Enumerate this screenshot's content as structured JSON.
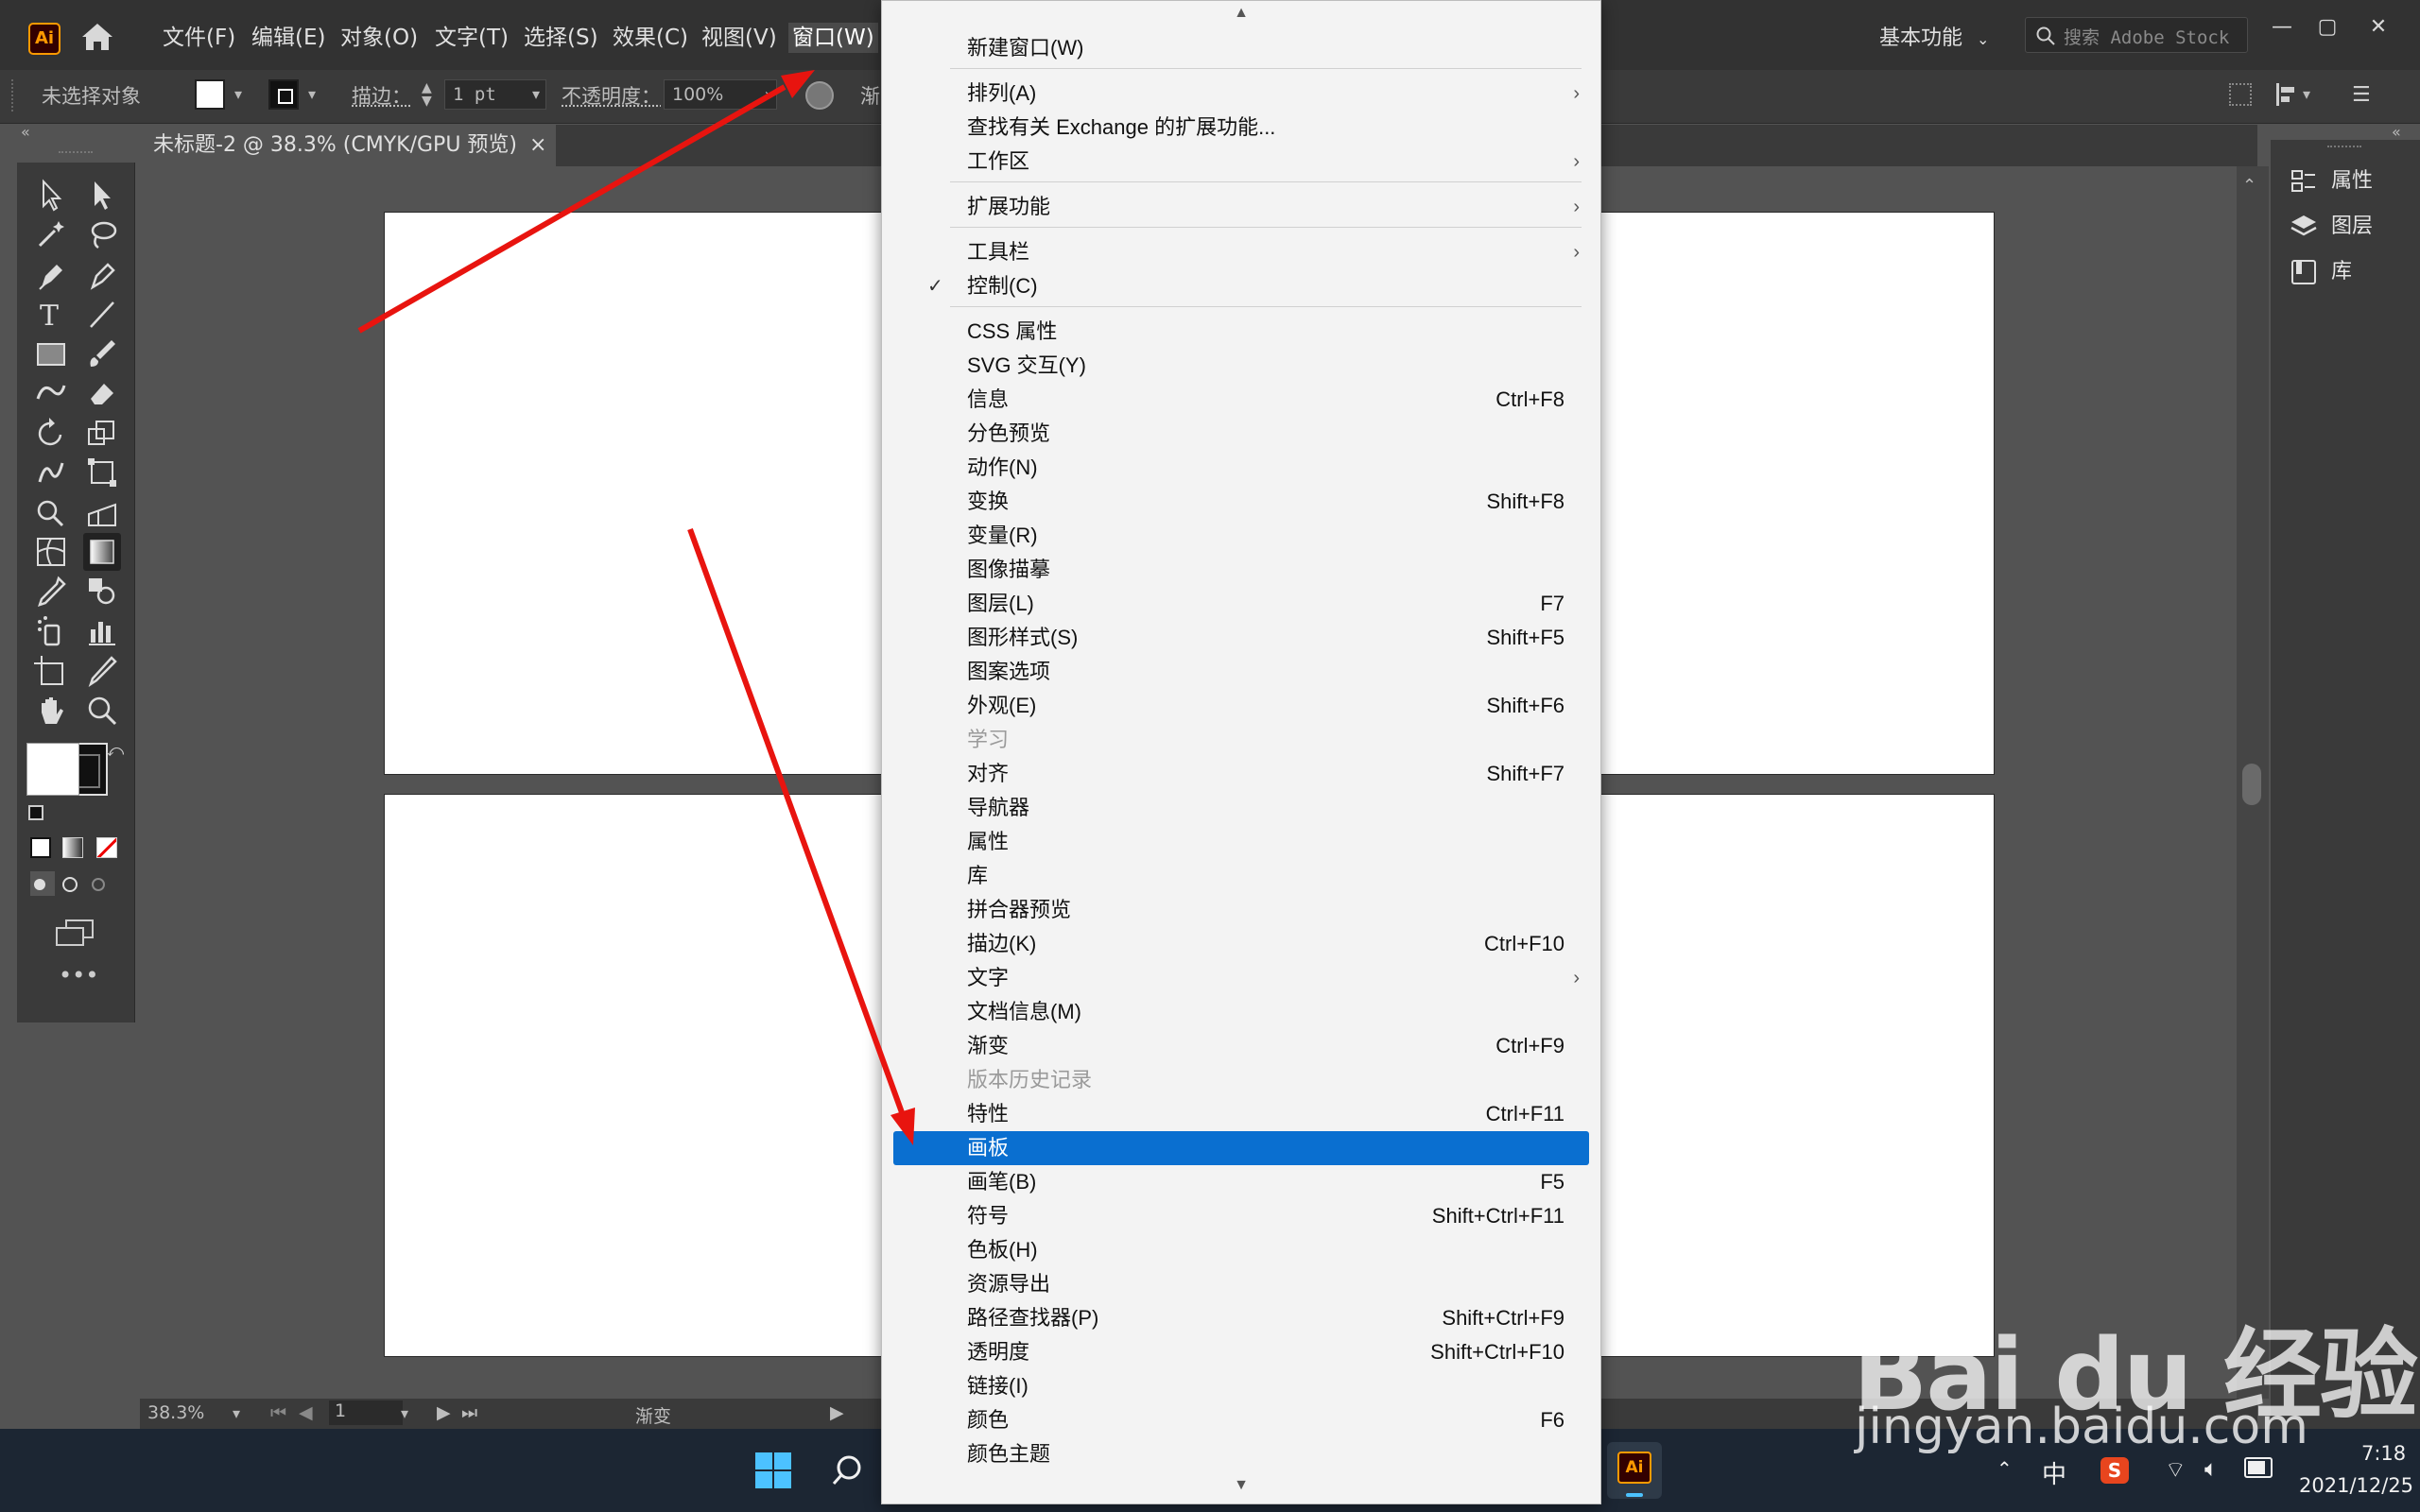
{
  "app": {
    "logo_text": "Ai",
    "accent": "#ff9a00"
  },
  "menubar": {
    "items": [
      "文件(F)",
      "编辑(E)",
      "对象(O)",
      "文字(T)",
      "选择(S)",
      "效果(C)",
      "视图(V)",
      "窗口(W)"
    ],
    "active": "窗口(W)",
    "workspace": "基本功能",
    "search_placeholder": "搜索 Adobe Stock"
  },
  "controlbar": {
    "selection": "未选择对象",
    "stroke_label": "描边：",
    "stroke_value": "1 pt",
    "opacity_label": "不透明度：",
    "opacity_value": "100%",
    "truncated_label": "渐"
  },
  "document_tab": {
    "title": "未标题-2 @ 38.3% (CMYK/GPU 预览)",
    "close": "×"
  },
  "statusbar": {
    "zoom": "38.3%",
    "artboard_index": "1",
    "tool_name": "渐变"
  },
  "right_panel": {
    "items": [
      "属性",
      "图层",
      "库"
    ]
  },
  "window_menu": {
    "items": [
      {
        "label": "新建窗口(W)",
        "shortcut": "",
        "submenu": false,
        "checked": false,
        "disabled": false,
        "selected": false
      },
      {
        "label": "排列(A)",
        "shortcut": "",
        "submenu": true,
        "checked": false,
        "disabled": false,
        "selected": false,
        "sep_before": true
      },
      {
        "label": "查找有关 Exchange 的扩展功能...",
        "shortcut": "",
        "submenu": false,
        "checked": false,
        "disabled": false,
        "selected": false
      },
      {
        "label": "工作区",
        "shortcut": "",
        "submenu": true,
        "checked": false,
        "disabled": false,
        "selected": false
      },
      {
        "label": "扩展功能",
        "shortcut": "",
        "submenu": true,
        "checked": false,
        "disabled": false,
        "selected": false,
        "sep_before": true
      },
      {
        "label": "工具栏",
        "shortcut": "",
        "submenu": true,
        "checked": false,
        "disabled": false,
        "selected": false,
        "sep_before": true
      },
      {
        "label": "控制(C)",
        "shortcut": "",
        "submenu": false,
        "checked": true,
        "disabled": false,
        "selected": false
      },
      {
        "label": "CSS 属性",
        "shortcut": "",
        "submenu": false,
        "checked": false,
        "disabled": false,
        "selected": false,
        "sep_before": true
      },
      {
        "label": "SVG 交互(Y)",
        "shortcut": "",
        "submenu": false,
        "checked": false,
        "disabled": false,
        "selected": false
      },
      {
        "label": "信息",
        "shortcut": "Ctrl+F8",
        "submenu": false,
        "checked": false,
        "disabled": false,
        "selected": false
      },
      {
        "label": "分色预览",
        "shortcut": "",
        "submenu": false,
        "checked": false,
        "disabled": false,
        "selected": false
      },
      {
        "label": "动作(N)",
        "shortcut": "",
        "submenu": false,
        "checked": false,
        "disabled": false,
        "selected": false
      },
      {
        "label": "变换",
        "shortcut": "Shift+F8",
        "submenu": false,
        "checked": false,
        "disabled": false,
        "selected": false
      },
      {
        "label": "变量(R)",
        "shortcut": "",
        "submenu": false,
        "checked": false,
        "disabled": false,
        "selected": false
      },
      {
        "label": "图像描摹",
        "shortcut": "",
        "submenu": false,
        "checked": false,
        "disabled": false,
        "selected": false
      },
      {
        "label": "图层(L)",
        "shortcut": "F7",
        "submenu": false,
        "checked": false,
        "disabled": false,
        "selected": false
      },
      {
        "label": "图形样式(S)",
        "shortcut": "Shift+F5",
        "submenu": false,
        "checked": false,
        "disabled": false,
        "selected": false
      },
      {
        "label": "图案选项",
        "shortcut": "",
        "submenu": false,
        "checked": false,
        "disabled": false,
        "selected": false
      },
      {
        "label": "外观(E)",
        "shortcut": "Shift+F6",
        "submenu": false,
        "checked": false,
        "disabled": false,
        "selected": false
      },
      {
        "label": "学习",
        "shortcut": "",
        "submenu": false,
        "checked": false,
        "disabled": true,
        "selected": false
      },
      {
        "label": "对齐",
        "shortcut": "Shift+F7",
        "submenu": false,
        "checked": false,
        "disabled": false,
        "selected": false
      },
      {
        "label": "导航器",
        "shortcut": "",
        "submenu": false,
        "checked": false,
        "disabled": false,
        "selected": false
      },
      {
        "label": "属性",
        "shortcut": "",
        "submenu": false,
        "checked": false,
        "disabled": false,
        "selected": false
      },
      {
        "label": "库",
        "shortcut": "",
        "submenu": false,
        "checked": false,
        "disabled": false,
        "selected": false
      },
      {
        "label": "拼合器预览",
        "shortcut": "",
        "submenu": false,
        "checked": false,
        "disabled": false,
        "selected": false
      },
      {
        "label": "描边(K)",
        "shortcut": "Ctrl+F10",
        "submenu": false,
        "checked": false,
        "disabled": false,
        "selected": false
      },
      {
        "label": "文字",
        "shortcut": "",
        "submenu": true,
        "checked": false,
        "disabled": false,
        "selected": false
      },
      {
        "label": "文档信息(M)",
        "shortcut": "",
        "submenu": false,
        "checked": false,
        "disabled": false,
        "selected": false
      },
      {
        "label": "渐变",
        "shortcut": "Ctrl+F9",
        "submenu": false,
        "checked": false,
        "disabled": false,
        "selected": false
      },
      {
        "label": "版本历史记录",
        "shortcut": "",
        "submenu": false,
        "checked": false,
        "disabled": true,
        "selected": false
      },
      {
        "label": "特性",
        "shortcut": "Ctrl+F11",
        "submenu": false,
        "checked": false,
        "disabled": false,
        "selected": false
      },
      {
        "label": "画板",
        "shortcut": "",
        "submenu": false,
        "checked": false,
        "disabled": false,
        "selected": true
      },
      {
        "label": "画笔(B)",
        "shortcut": "F5",
        "submenu": false,
        "checked": false,
        "disabled": false,
        "selected": false
      },
      {
        "label": "符号",
        "shortcut": "Shift+Ctrl+F11",
        "submenu": false,
        "checked": false,
        "disabled": false,
        "selected": false
      },
      {
        "label": "色板(H)",
        "shortcut": "",
        "submenu": false,
        "checked": false,
        "disabled": false,
        "selected": false
      },
      {
        "label": "资源导出",
        "shortcut": "",
        "submenu": false,
        "checked": false,
        "disabled": false,
        "selected": false
      },
      {
        "label": "路径查找器(P)",
        "shortcut": "Shift+Ctrl+F9",
        "submenu": false,
        "checked": false,
        "disabled": false,
        "selected": false
      },
      {
        "label": "透明度",
        "shortcut": "Shift+Ctrl+F10",
        "submenu": false,
        "checked": false,
        "disabled": false,
        "selected": false
      },
      {
        "label": "链接(I)",
        "shortcut": "",
        "submenu": false,
        "checked": false,
        "disabled": false,
        "selected": false
      },
      {
        "label": "颜色",
        "shortcut": "F6",
        "submenu": false,
        "checked": false,
        "disabled": false,
        "selected": false
      },
      {
        "label": "颜色主题",
        "shortcut": "",
        "submenu": false,
        "checked": false,
        "disabled": false,
        "selected": false
      }
    ]
  },
  "taskbar": {
    "ime": "中",
    "time": "7:18",
    "date": "2021/12/25"
  },
  "watermark": {
    "main": "Bai du 经验",
    "sub": "jingyan.baidu.com"
  },
  "colors": {
    "menu_highlight": "#0a6fd0",
    "annotation_arrow": "#e8140f",
    "canvas_bg": "#535353"
  }
}
